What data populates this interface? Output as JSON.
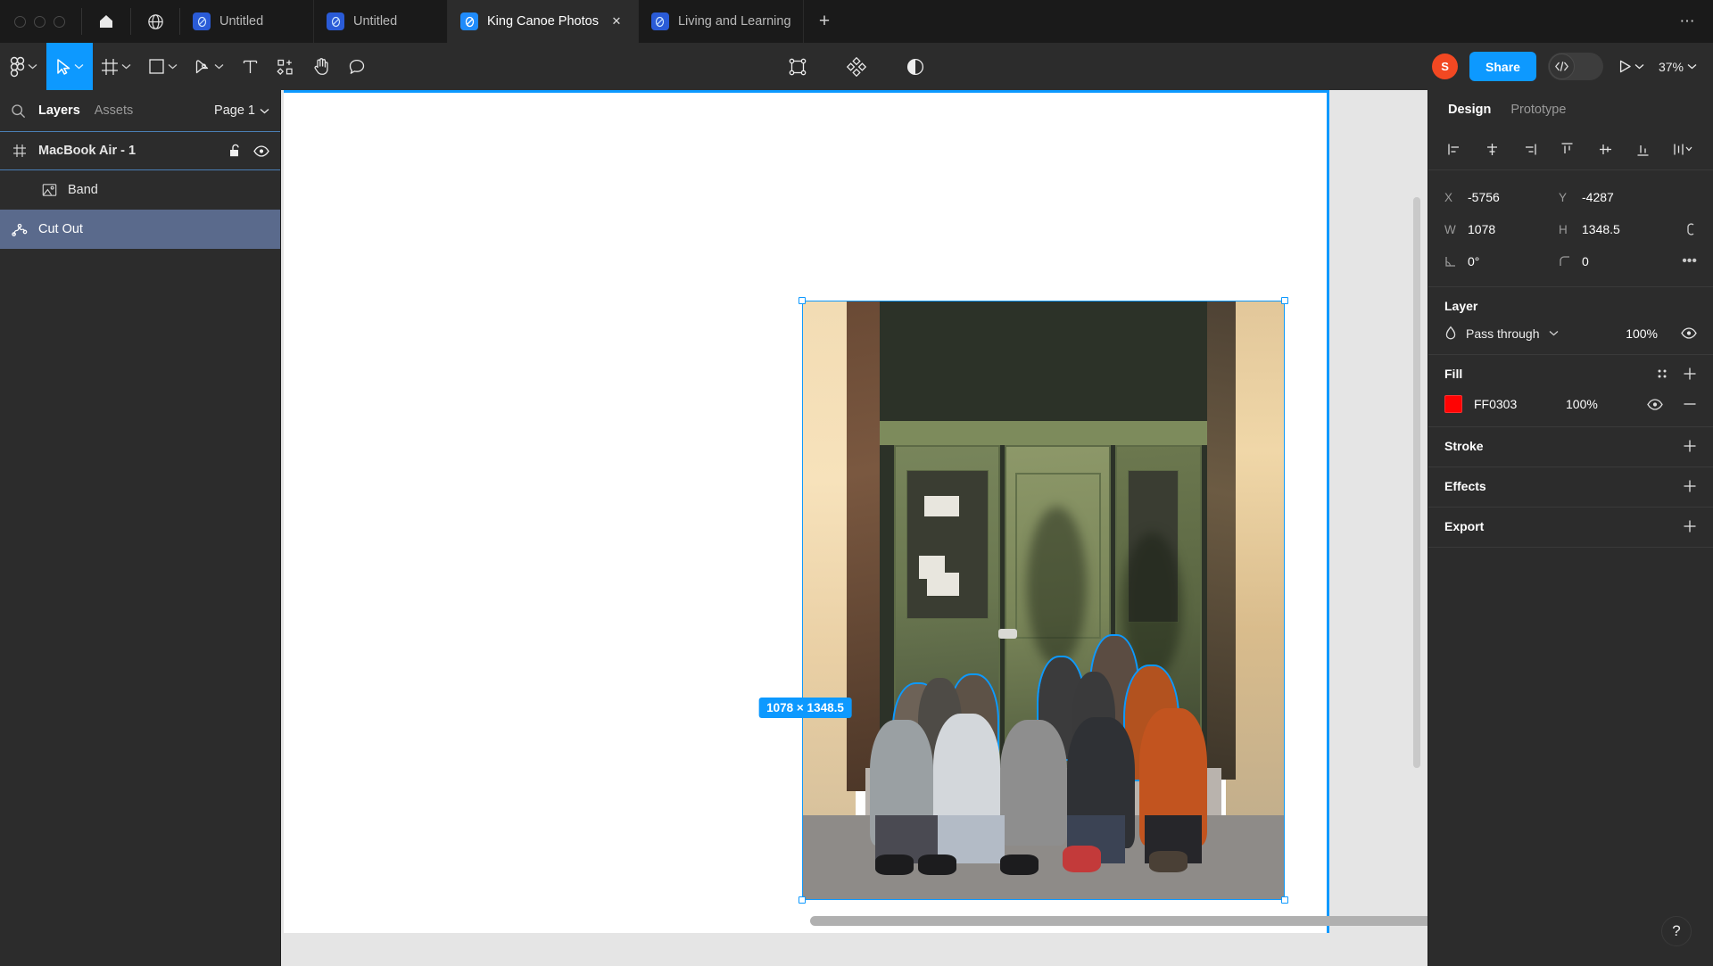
{
  "window": {
    "traffic_lights": [
      "close",
      "minimize",
      "maximize"
    ],
    "home_icon": "home-icon",
    "globe_icon": "globe-icon",
    "new_tab_label": "+",
    "more_label": "⋯"
  },
  "tabs": [
    {
      "label": "Untitled",
      "active": false,
      "closable": false
    },
    {
      "label": "Untitled",
      "active": false,
      "closable": false
    },
    {
      "label": "King Canoe Photos",
      "active": true,
      "closable": true,
      "close_label": "✕"
    },
    {
      "label": "Living and Learning Centre - Berwick",
      "active": false,
      "closable": false
    }
  ],
  "toolbar": {
    "left_tools": [
      {
        "name": "figma-menu-icon",
        "caret": true,
        "selected": false
      },
      {
        "name": "move-cursor-icon",
        "caret": true,
        "selected": true
      },
      {
        "name": "frame-icon",
        "caret": true,
        "selected": false
      },
      {
        "name": "shape-rectangle-icon",
        "caret": true,
        "selected": false
      },
      {
        "name": "pen-icon",
        "caret": true,
        "selected": false
      },
      {
        "name": "text-icon",
        "caret": false,
        "selected": false
      },
      {
        "name": "components-icon",
        "caret": false,
        "selected": false
      },
      {
        "name": "hand-icon",
        "caret": false,
        "selected": false
      },
      {
        "name": "comment-icon",
        "caret": false,
        "selected": false
      }
    ],
    "center_tools": [
      {
        "name": "vector-edit-icon"
      },
      {
        "name": "plugins-diamond-icon"
      },
      {
        "name": "contrast-icon"
      }
    ],
    "avatar_initial": "S",
    "share_label": "Share",
    "dev_mode_icon": "code-brackets-icon",
    "present_icon": "play-icon",
    "zoom_level": "37%"
  },
  "left_panel": {
    "search_icon": "search-icon",
    "tabs": [
      {
        "label": "Layers",
        "active": true
      },
      {
        "label": "Assets",
        "active": false
      }
    ],
    "page_selector": "Page 1",
    "layers": [
      {
        "name": "MacBook Air - 1",
        "icon": "frame-icon",
        "type": "frame",
        "selected": false,
        "actions": [
          "unlock-icon",
          "eye-icon"
        ],
        "indent": 0
      },
      {
        "name": "Band",
        "icon": "image-icon",
        "type": "image",
        "selected": false,
        "actions": [],
        "indent": 1
      },
      {
        "name": "Cut Out",
        "icon": "vector-path-icon",
        "type": "vector",
        "selected": true,
        "actions": [],
        "indent": 0
      }
    ]
  },
  "right_panel": {
    "tabs": [
      {
        "label": "Design",
        "active": true
      },
      {
        "label": "Prototype",
        "active": false
      }
    ],
    "align_buttons": [
      "align-left-icon",
      "align-horizontal-center-icon",
      "align-right-icon",
      "align-top-icon",
      "align-vertical-center-icon",
      "align-bottom-icon",
      "distribute-icon"
    ],
    "properties": {
      "x_label": "X",
      "x_value": "-5756",
      "y_label": "Y",
      "y_value": "-4287",
      "w_label": "W",
      "w_value": "1078",
      "h_label": "H",
      "h_value": "1348.5",
      "constrain_icon": "link-proportions-icon",
      "rotation_label": "rotation-icon",
      "rotation_value": "0°",
      "corner_label": "corner-radius-icon",
      "corner_value": "0",
      "more_label": "•••"
    },
    "layer_section": {
      "title": "Layer",
      "blend_icon": "blend-mode-icon",
      "blend_mode": "Pass through",
      "opacity": "100%",
      "visibility_icon": "eye-icon"
    },
    "fill_section": {
      "title": "Fill",
      "style_icon": "styles-grid-icon",
      "add_icon": "plus-icon",
      "items": [
        {
          "color": "#FF0303",
          "hex": "FF0303",
          "opacity": "100%",
          "visibility_icon": "eye-icon",
          "remove_icon": "minus-icon"
        }
      ]
    },
    "collapsed_sections": [
      {
        "title": "Stroke",
        "add_icon": "plus-icon"
      },
      {
        "title": "Effects",
        "add_icon": "plus-icon"
      },
      {
        "title": "Export",
        "add_icon": "plus-icon"
      }
    ]
  },
  "canvas": {
    "selection_dimensions": "1078 × 1348.5",
    "artwork_alt": "band-group-photo",
    "selection_color": "#0D99FF"
  },
  "help_button": {
    "label": "?"
  }
}
